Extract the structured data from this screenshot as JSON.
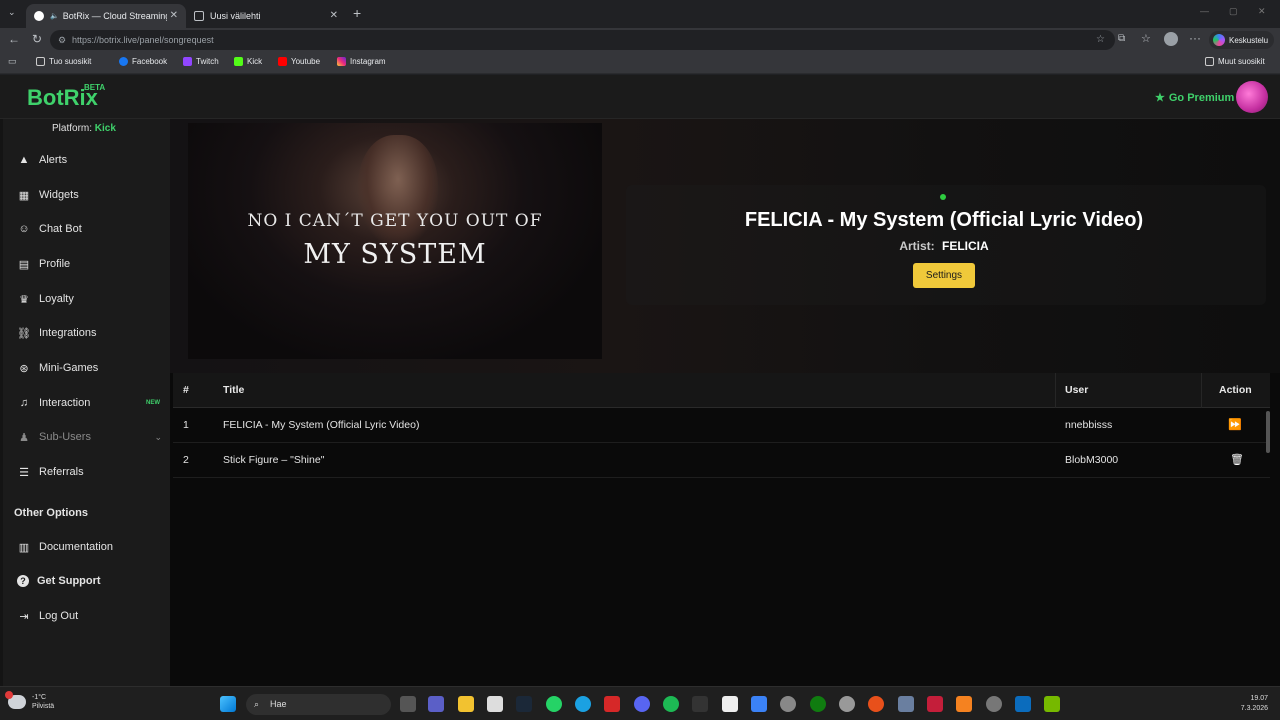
{
  "browser": {
    "tabs": [
      {
        "title": "BotRix — Cloud Streaming Bo",
        "active": true
      },
      {
        "title": "Uusi välilehti",
        "active": false
      }
    ],
    "url": "https://botrix.live/panel/songrequest",
    "profile_label": "Keskustelu",
    "bookmarks": [
      "Tuo suosikit",
      "Facebook",
      "Twitch",
      "Kick",
      "Youtube",
      "Instagram"
    ],
    "other_bookmarks": "Muut suosikit",
    "icons": [
      "back-icon",
      "reload-icon",
      "star-icon",
      "extensions-icon",
      "favorites-icon",
      "profile-icon",
      "menu-icon"
    ]
  },
  "header": {
    "logo": "BotRix",
    "beta": "BETA",
    "premium_label": "Go Premium"
  },
  "sidebar": {
    "platform_label": "Platform:",
    "platform_value": "Kick",
    "items": [
      {
        "label": "Alerts",
        "icon": "warning-icon"
      },
      {
        "label": "Widgets",
        "icon": "grid-icon"
      },
      {
        "label": "Chat Bot",
        "icon": "robot-icon"
      },
      {
        "label": "Profile",
        "icon": "id-card-icon"
      },
      {
        "label": "Loyalty",
        "icon": "trophy-icon"
      },
      {
        "label": "Integrations",
        "icon": "link-icon"
      },
      {
        "label": "Mini-Games",
        "icon": "gamepad-icon"
      },
      {
        "label": "Interaction",
        "icon": "music-icon",
        "badge": "NEW"
      },
      {
        "label": "Sub-Users",
        "icon": "users-icon"
      },
      {
        "label": "Referrals",
        "icon": "user-list-icon"
      }
    ],
    "other_header": "Other Options",
    "other_items": [
      {
        "label": "Documentation",
        "icon": "book-icon"
      },
      {
        "label": "Get Support",
        "icon": "question-icon"
      },
      {
        "label": "Log Out",
        "icon": "logout-icon"
      }
    ]
  },
  "player": {
    "lyric_line1": "NO I CAN´T GET YOU OUT OF",
    "lyric_line2": "MY SYSTEM",
    "song_title": "FELICIA - My System (Official Lyric Video)",
    "artist_label": "Artist:",
    "artist_value": "FELICIA",
    "settings_label": "Settings"
  },
  "queue": {
    "columns": [
      "#",
      "Title",
      "User",
      "Action"
    ],
    "rows": [
      {
        "num": "1",
        "title": "FELICIA - My System (Official Lyric Video)",
        "user": "nnebbisss",
        "action_icon": "skip-forward-icon"
      },
      {
        "num": "2",
        "title": "Stick Figure – \"Shine\"",
        "user": "BlobM3000",
        "action_icon": "trash-icon"
      }
    ]
  },
  "taskbar": {
    "weather_temp": "-1°C",
    "weather_desc": "Pilvistä",
    "search_placeholder": "Hae",
    "time": "19.07",
    "date": "7.3.2026"
  }
}
